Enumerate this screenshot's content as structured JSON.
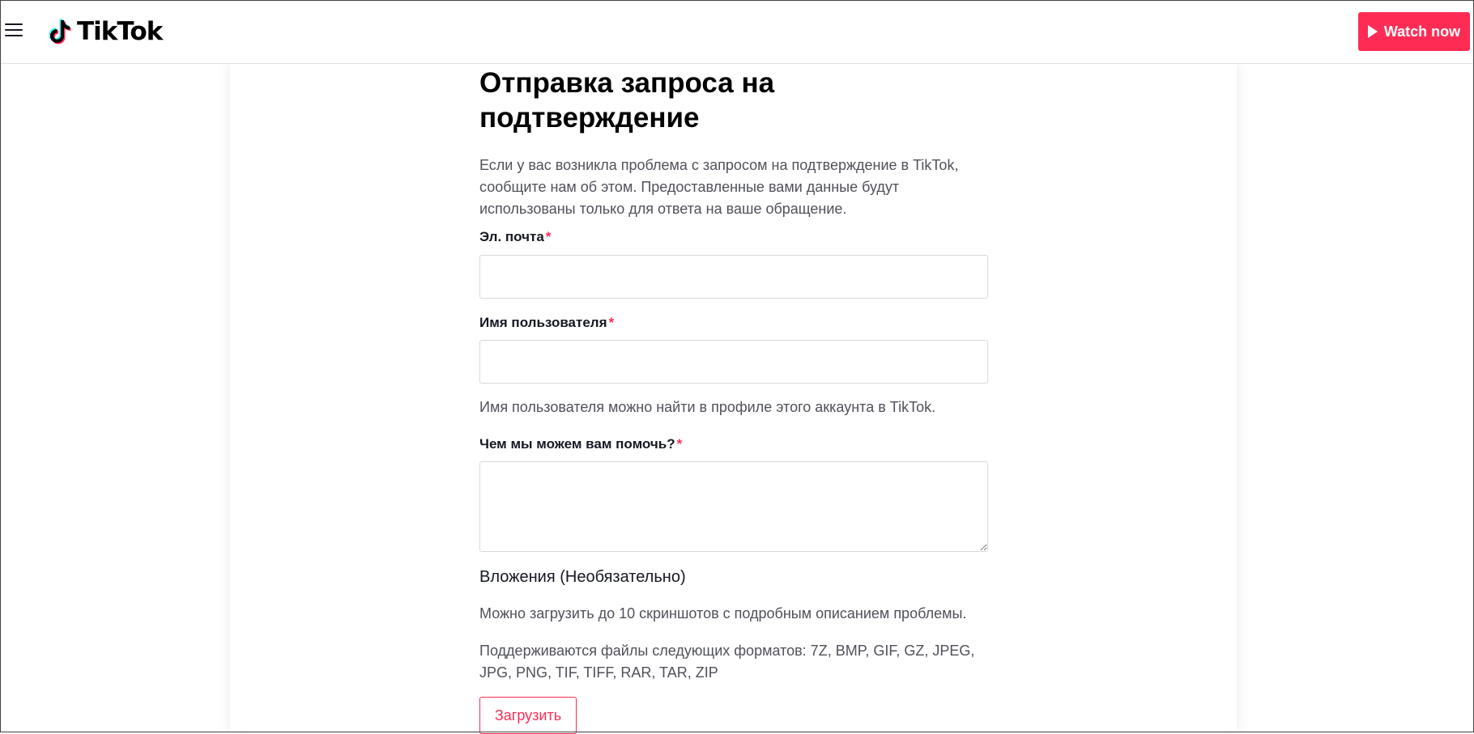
{
  "header": {
    "logo_text": "TikTok",
    "watch_label": "Watch now",
    "accent_color": "#fe2c55",
    "menu_icon": "hamburger-menu-icon",
    "play_icon": "play-icon"
  },
  "form": {
    "title": "Отправка запроса на подтверждение",
    "intro": "Если у вас возникла проблема с запросом на подтверждение в TikTok, сообщите нам об этом. Предоставленные вами данные будут использованы только для ответа на ваше обращение.",
    "email": {
      "label": "Эл. почта",
      "required_mark": "*",
      "value": ""
    },
    "username": {
      "label": "Имя пользователя",
      "required_mark": "*",
      "value": "",
      "hint": "Имя пользователя можно найти в профиле этого аккаунта в TikTok."
    },
    "help": {
      "label": "Чем мы можем вам помочь?",
      "required_mark": "*",
      "value": ""
    },
    "attachments": {
      "title": "Вложения (Необязательно)",
      "limit_text": "Можно загрузить до 10 скриншотов с подробным описанием проблемы.",
      "formats_text": "Поддерживаются файлы следующих форматов: 7Z, BMP, GIF, GZ, JPEG, JPG, PNG, TIF, TIFF, RAR, TAR, ZIP",
      "upload_label": "Загрузить"
    }
  }
}
